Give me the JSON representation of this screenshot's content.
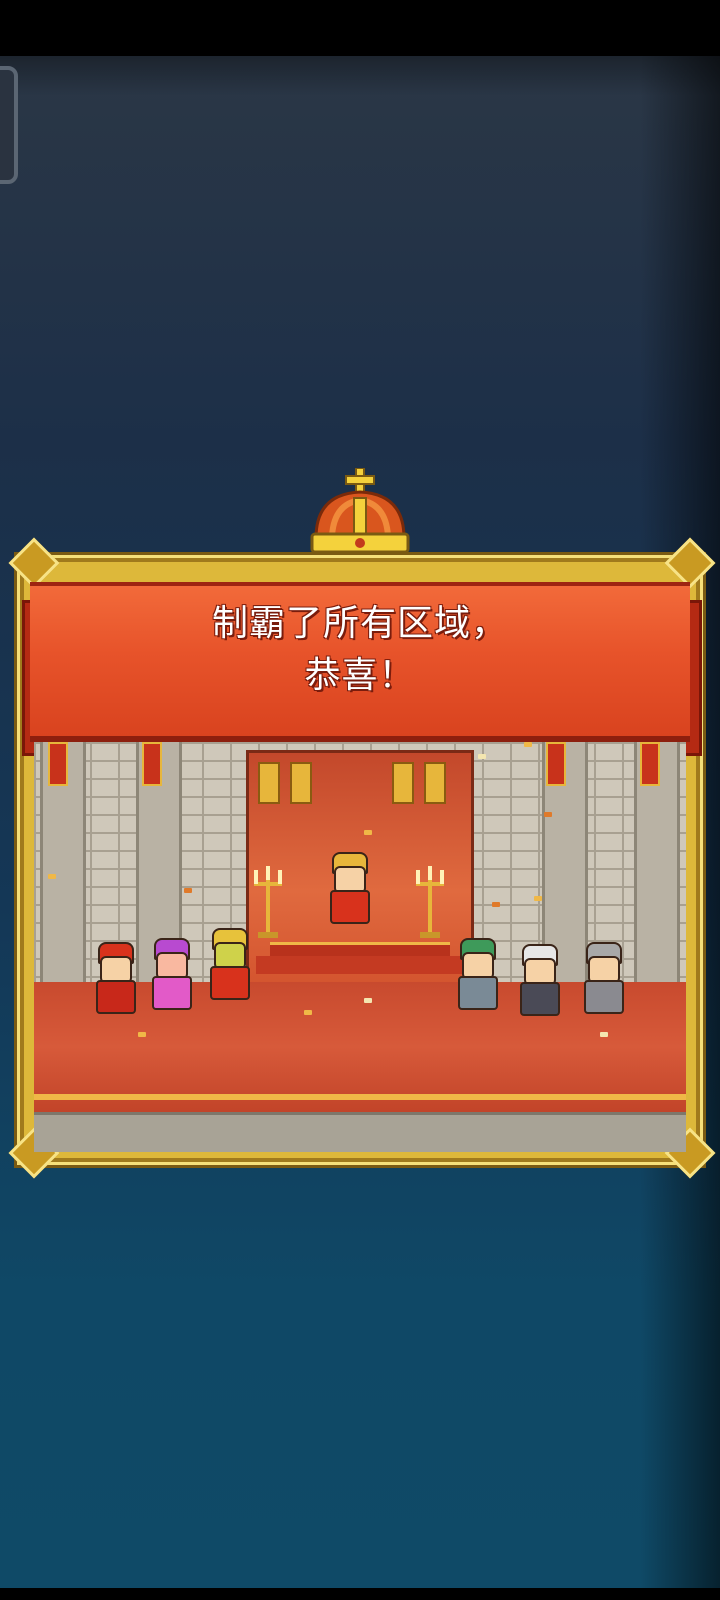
{
  "banner": {
    "line1": "制霸了所有区域，",
    "line2": "恭喜！"
  },
  "colors": {
    "banner_red": "#e7532a",
    "frame_gold": "#ddb83a",
    "carpet_red": "#d75a3a",
    "background_navy": "#1c2f48"
  },
  "scene": {
    "description_icons": [
      "crown-icon",
      "throne-icon",
      "candelabra-icon",
      "confetti"
    ]
  }
}
